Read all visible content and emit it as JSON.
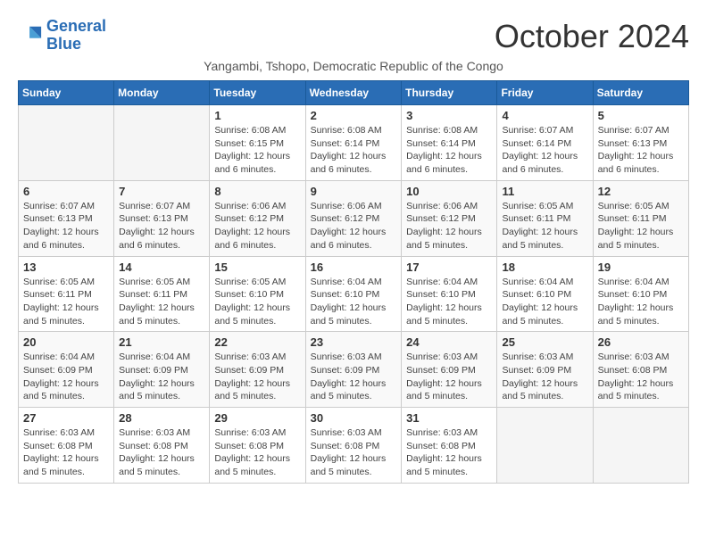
{
  "logo": {
    "line1": "General",
    "line2": "Blue"
  },
  "title": "October 2024",
  "subtitle": "Yangambi, Tshopo, Democratic Republic of the Congo",
  "days_header": [
    "Sunday",
    "Monday",
    "Tuesday",
    "Wednesday",
    "Thursday",
    "Friday",
    "Saturday"
  ],
  "weeks": [
    [
      {
        "num": "",
        "info": ""
      },
      {
        "num": "",
        "info": ""
      },
      {
        "num": "1",
        "info": "Sunrise: 6:08 AM\nSunset: 6:15 PM\nDaylight: 12 hours and 6 minutes."
      },
      {
        "num": "2",
        "info": "Sunrise: 6:08 AM\nSunset: 6:14 PM\nDaylight: 12 hours and 6 minutes."
      },
      {
        "num": "3",
        "info": "Sunrise: 6:08 AM\nSunset: 6:14 PM\nDaylight: 12 hours and 6 minutes."
      },
      {
        "num": "4",
        "info": "Sunrise: 6:07 AM\nSunset: 6:14 PM\nDaylight: 12 hours and 6 minutes."
      },
      {
        "num": "5",
        "info": "Sunrise: 6:07 AM\nSunset: 6:13 PM\nDaylight: 12 hours and 6 minutes."
      }
    ],
    [
      {
        "num": "6",
        "info": "Sunrise: 6:07 AM\nSunset: 6:13 PM\nDaylight: 12 hours and 6 minutes."
      },
      {
        "num": "7",
        "info": "Sunrise: 6:07 AM\nSunset: 6:13 PM\nDaylight: 12 hours and 6 minutes."
      },
      {
        "num": "8",
        "info": "Sunrise: 6:06 AM\nSunset: 6:12 PM\nDaylight: 12 hours and 6 minutes."
      },
      {
        "num": "9",
        "info": "Sunrise: 6:06 AM\nSunset: 6:12 PM\nDaylight: 12 hours and 6 minutes."
      },
      {
        "num": "10",
        "info": "Sunrise: 6:06 AM\nSunset: 6:12 PM\nDaylight: 12 hours and 5 minutes."
      },
      {
        "num": "11",
        "info": "Sunrise: 6:05 AM\nSunset: 6:11 PM\nDaylight: 12 hours and 5 minutes."
      },
      {
        "num": "12",
        "info": "Sunrise: 6:05 AM\nSunset: 6:11 PM\nDaylight: 12 hours and 5 minutes."
      }
    ],
    [
      {
        "num": "13",
        "info": "Sunrise: 6:05 AM\nSunset: 6:11 PM\nDaylight: 12 hours and 5 minutes."
      },
      {
        "num": "14",
        "info": "Sunrise: 6:05 AM\nSunset: 6:11 PM\nDaylight: 12 hours and 5 minutes."
      },
      {
        "num": "15",
        "info": "Sunrise: 6:05 AM\nSunset: 6:10 PM\nDaylight: 12 hours and 5 minutes."
      },
      {
        "num": "16",
        "info": "Sunrise: 6:04 AM\nSunset: 6:10 PM\nDaylight: 12 hours and 5 minutes."
      },
      {
        "num": "17",
        "info": "Sunrise: 6:04 AM\nSunset: 6:10 PM\nDaylight: 12 hours and 5 minutes."
      },
      {
        "num": "18",
        "info": "Sunrise: 6:04 AM\nSunset: 6:10 PM\nDaylight: 12 hours and 5 minutes."
      },
      {
        "num": "19",
        "info": "Sunrise: 6:04 AM\nSunset: 6:10 PM\nDaylight: 12 hours and 5 minutes."
      }
    ],
    [
      {
        "num": "20",
        "info": "Sunrise: 6:04 AM\nSunset: 6:09 PM\nDaylight: 12 hours and 5 minutes."
      },
      {
        "num": "21",
        "info": "Sunrise: 6:04 AM\nSunset: 6:09 PM\nDaylight: 12 hours and 5 minutes."
      },
      {
        "num": "22",
        "info": "Sunrise: 6:03 AM\nSunset: 6:09 PM\nDaylight: 12 hours and 5 minutes."
      },
      {
        "num": "23",
        "info": "Sunrise: 6:03 AM\nSunset: 6:09 PM\nDaylight: 12 hours and 5 minutes."
      },
      {
        "num": "24",
        "info": "Sunrise: 6:03 AM\nSunset: 6:09 PM\nDaylight: 12 hours and 5 minutes."
      },
      {
        "num": "25",
        "info": "Sunrise: 6:03 AM\nSunset: 6:09 PM\nDaylight: 12 hours and 5 minutes."
      },
      {
        "num": "26",
        "info": "Sunrise: 6:03 AM\nSunset: 6:08 PM\nDaylight: 12 hours and 5 minutes."
      }
    ],
    [
      {
        "num": "27",
        "info": "Sunrise: 6:03 AM\nSunset: 6:08 PM\nDaylight: 12 hours and 5 minutes."
      },
      {
        "num": "28",
        "info": "Sunrise: 6:03 AM\nSunset: 6:08 PM\nDaylight: 12 hours and 5 minutes."
      },
      {
        "num": "29",
        "info": "Sunrise: 6:03 AM\nSunset: 6:08 PM\nDaylight: 12 hours and 5 minutes."
      },
      {
        "num": "30",
        "info": "Sunrise: 6:03 AM\nSunset: 6:08 PM\nDaylight: 12 hours and 5 minutes."
      },
      {
        "num": "31",
        "info": "Sunrise: 6:03 AM\nSunset: 6:08 PM\nDaylight: 12 hours and 5 minutes."
      },
      {
        "num": "",
        "info": ""
      },
      {
        "num": "",
        "info": ""
      }
    ]
  ]
}
